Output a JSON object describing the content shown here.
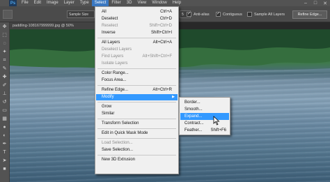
{
  "menubar": {
    "logo": "Ps",
    "items": [
      "File",
      "Edit",
      "Image",
      "Layer",
      "Type",
      "Select",
      "Filter",
      "3D",
      "View",
      "Window",
      "Help"
    ],
    "active_index": 5,
    "window_buttons": [
      "–",
      "□",
      "✕"
    ]
  },
  "options": {
    "sample_size": "Sample Size",
    "tolerance_value": "5",
    "anti_alias": "Anti-alias",
    "contiguous": "Contiguous",
    "sample_all_layers": "Sample All Layers",
    "refine_edge": "Refine Edge..."
  },
  "document": {
    "tab_title": "paddling-108167999999.jpg @ 50%"
  },
  "select_menu": {
    "items": [
      {
        "label": "All",
        "shortcut": "Ctrl+A",
        "disabled": false
      },
      {
        "label": "Deselect",
        "shortcut": "Ctrl+D",
        "disabled": false
      },
      {
        "label": "Reselect",
        "shortcut": "Shift+Ctrl+D",
        "disabled": true
      },
      {
        "label": "Inverse",
        "shortcut": "Shift+Ctrl+I",
        "disabled": false
      },
      {
        "label": "All Layers",
        "shortcut": "Alt+Ctrl+A",
        "disabled": false
      },
      {
        "label": "Deselect Layers",
        "shortcut": "",
        "disabled": true
      },
      {
        "label": "Find Layers",
        "shortcut": "Alt+Shift+Ctrl+F",
        "disabled": true
      },
      {
        "label": "Isolate Layers",
        "shortcut": "",
        "disabled": true
      },
      {
        "label": "Color Range...",
        "shortcut": "",
        "disabled": false
      },
      {
        "label": "Focus Area...",
        "shortcut": "",
        "disabled": false
      },
      {
        "label": "Refine Edge...",
        "shortcut": "Alt+Ctrl+R",
        "disabled": false
      },
      {
        "label": "Modify",
        "shortcut": "",
        "disabled": false
      },
      {
        "label": "Grow",
        "shortcut": "",
        "disabled": false
      },
      {
        "label": "Similar",
        "shortcut": "",
        "disabled": false
      },
      {
        "label": "Transform Selection",
        "shortcut": "",
        "disabled": false
      },
      {
        "label": "Edit in Quick Mask Mode",
        "shortcut": "",
        "disabled": false
      },
      {
        "label": "Load Selection...",
        "shortcut": "",
        "disabled": true
      },
      {
        "label": "Save Selection...",
        "shortcut": "",
        "disabled": false
      },
      {
        "label": "New 3D Extrusion",
        "shortcut": "",
        "disabled": false
      }
    ],
    "highlighted": "Modify"
  },
  "modify_submenu": {
    "items": [
      {
        "label": "Border...",
        "shortcut": ""
      },
      {
        "label": "Smooth...",
        "shortcut": ""
      },
      {
        "label": "Expand...",
        "shortcut": ""
      },
      {
        "label": "Contract...",
        "shortcut": ""
      },
      {
        "label": "Feather...",
        "shortcut": "Shift+F6"
      }
    ],
    "highlighted": "Expand..."
  },
  "colors": {
    "menu_highlight": "#3399ff",
    "menubar_active": "#3a78c2"
  }
}
